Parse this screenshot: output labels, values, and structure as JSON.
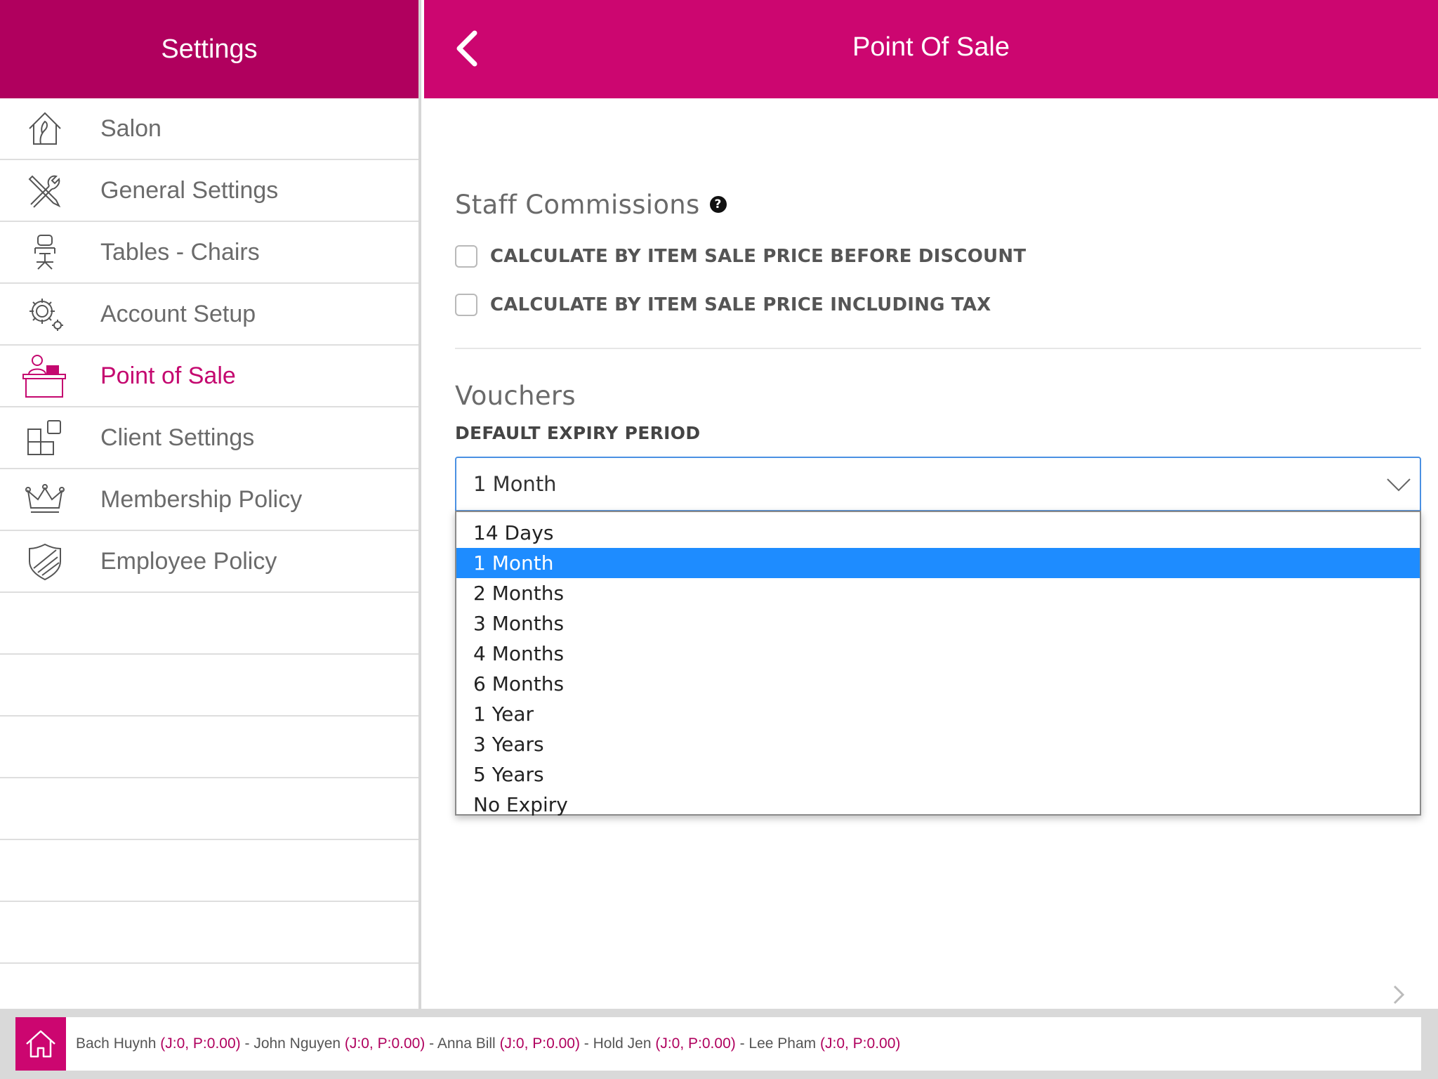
{
  "sidebar": {
    "title": "Settings",
    "items": [
      {
        "label": "Salon",
        "icon": "salon-icon"
      },
      {
        "label": "General Settings",
        "icon": "tools-icon"
      },
      {
        "label": "Tables - Chairs",
        "icon": "chair-icon"
      },
      {
        "label": "Account Setup",
        "icon": "gear-icon"
      },
      {
        "label": "Point of Sale",
        "icon": "cashier-icon",
        "active": true
      },
      {
        "label": "Client Settings",
        "icon": "blocks-icon"
      },
      {
        "label": "Membership Policy",
        "icon": "crown-icon"
      },
      {
        "label": "Employee Policy",
        "icon": "shield-icon"
      }
    ]
  },
  "header": {
    "title": "Point Of Sale"
  },
  "staff_commissions": {
    "title": "Staff Commissions",
    "help": "?",
    "options": [
      {
        "label": "CALCULATE BY ITEM SALE PRICE BEFORE DISCOUNT",
        "checked": false
      },
      {
        "label": "CALCULATE BY ITEM SALE PRICE INCLUDING TAX",
        "checked": false
      }
    ]
  },
  "vouchers": {
    "title": "Vouchers",
    "expiry_label": "DEFAULT EXPIRY PERIOD",
    "selected": "1 Month",
    "options": [
      "14 Days",
      "1 Month",
      "2 Months",
      "3 Months",
      "4 Months",
      "6 Months",
      "1 Year",
      "3 Years",
      "5 Years",
      "No Expiry"
    ]
  },
  "footer": {
    "staff": [
      {
        "name": "Bach Huynh",
        "stat": "(J:0, P:0.00)"
      },
      {
        "name": "John Nguyen",
        "stat": "(J:0, P:0.00)"
      },
      {
        "name": "Anna Bill",
        "stat": "(J:0, P:0.00)"
      },
      {
        "name": "Hold Jen",
        "stat": "(J:0, P:0.00)"
      },
      {
        "name": "Lee Pham",
        "stat": "(J:0, P:0.00)"
      }
    ],
    "separator": " - "
  },
  "colors": {
    "brand_dark": "#b0005e",
    "brand": "#cc0670",
    "active_text": "#c4076f",
    "selection": "#1e8cff"
  }
}
